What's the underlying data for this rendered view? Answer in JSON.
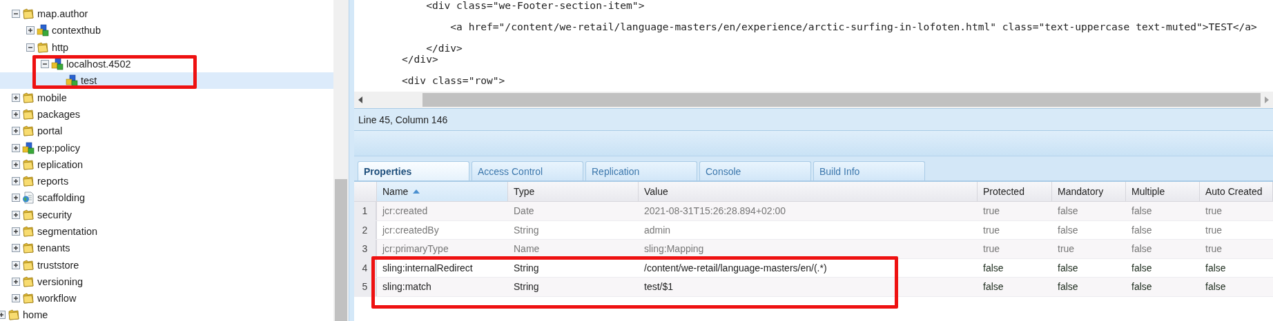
{
  "tree": [
    {
      "children": [
        {
          "label": "map.author",
          "kind": "folder",
          "expanded": true,
          "selected": false,
          "highlighted": false,
          "children": [
            {
              "label": "contexthub",
              "kind": "node",
              "expanded": false,
              "selected": false,
              "highlighted": false
            },
            {
              "label": "http",
              "kind": "folder",
              "expanded": true,
              "selected": false,
              "highlighted": false,
              "children": [
                {
                  "label": "localhost.4502",
                  "kind": "node",
                  "expanded": true,
                  "selected": false,
                  "highlighted": true,
                  "children": [
                    {
                      "label": "test",
                      "kind": "node",
                      "selected": true,
                      "highlighted": true
                    }
                  ]
                }
              ]
            }
          ]
        },
        {
          "label": "mobile",
          "kind": "folder",
          "expanded": false,
          "selected": false,
          "highlighted": false
        },
        {
          "label": "packages",
          "kind": "folder",
          "expanded": false,
          "selected": false,
          "highlighted": false
        },
        {
          "label": "portal",
          "kind": "folder",
          "expanded": false,
          "selected": false,
          "highlighted": false
        },
        {
          "label": "rep:policy",
          "kind": "node",
          "expanded": false,
          "selected": false,
          "highlighted": false
        },
        {
          "label": "replication",
          "kind": "folder",
          "expanded": false,
          "selected": false,
          "highlighted": false
        },
        {
          "label": "reports",
          "kind": "folder",
          "expanded": false,
          "selected": false,
          "highlighted": false
        },
        {
          "label": "scaffolding",
          "kind": "page",
          "expanded": false,
          "selected": false,
          "highlighted": false
        },
        {
          "label": "security",
          "kind": "folder",
          "expanded": false,
          "selected": false,
          "highlighted": false
        },
        {
          "label": "segmentation",
          "kind": "folder",
          "expanded": false,
          "selected": false,
          "highlighted": false
        },
        {
          "label": "tenants",
          "kind": "folder",
          "expanded": false,
          "selected": false,
          "highlighted": false
        },
        {
          "label": "truststore",
          "kind": "folder",
          "expanded": false,
          "selected": false,
          "highlighted": false
        },
        {
          "label": "versioning",
          "kind": "folder",
          "expanded": false,
          "selected": false,
          "highlighted": false
        },
        {
          "label": "workflow",
          "kind": "folder",
          "expanded": false,
          "selected": false,
          "highlighted": false
        }
      ]
    },
    {
      "label": "home",
      "kind": "folder",
      "expanded": false,
      "selected": false,
      "highlighted": false
    }
  ],
  "code_blocks": [
    [
      "    <div class=\"we-Footer-section-item\">"
    ],
    [
      "        <a href=\"/content/we-retail/language-masters/en/experience/arctic-surfing-in-lofoten.html\" class=\"text-uppercase text-muted\">TEST</a>"
    ],
    [
      "    </div>",
      "</div>"
    ],
    [
      "<div class=\"row\">"
    ]
  ],
  "status_bar": "Line 45, Column 146",
  "tabs": [
    {
      "label": "Properties",
      "selected": true
    },
    {
      "label": "Access Control",
      "selected": false
    },
    {
      "label": "Replication",
      "selected": false
    },
    {
      "label": "Console",
      "selected": false
    },
    {
      "label": "Build Info",
      "selected": false
    }
  ],
  "table": {
    "columns": [
      {
        "label": "Name",
        "sorted": true
      },
      {
        "label": "Type",
        "sorted": false
      },
      {
        "label": "Value",
        "sorted": false
      },
      {
        "label": "Protected",
        "sorted": false
      },
      {
        "label": "Mandatory",
        "sorted": false
      },
      {
        "label": "Multiple",
        "sorted": false
      },
      {
        "label": "Auto Created",
        "sorted": false
      }
    ],
    "rows": [
      {
        "number": "1",
        "cells": [
          "jcr:created",
          "Date",
          "2021-08-31T15:26:28.894+02:00",
          "true",
          "false",
          "false",
          "true"
        ],
        "disabled": true,
        "highlighted": false
      },
      {
        "number": "2",
        "cells": [
          "jcr:createdBy",
          "String",
          "admin",
          "true",
          "false",
          "false",
          "true"
        ],
        "disabled": true,
        "highlighted": false
      },
      {
        "number": "3",
        "cells": [
          "jcr:primaryType",
          "Name",
          "sling:Mapping",
          "true",
          "true",
          "false",
          "true"
        ],
        "disabled": true,
        "highlighted": false
      },
      {
        "number": "4",
        "cells": [
          "sling:internalRedirect",
          "String",
          "/content/we-retail/language-masters/en/(.*)",
          "false",
          "false",
          "false",
          "false"
        ],
        "disabled": false,
        "highlighted": true
      },
      {
        "number": "5",
        "cells": [
          "sling:match",
          "String",
          "test/$1",
          "false",
          "false",
          "false",
          "false"
        ],
        "disabled": false,
        "highlighted": true
      }
    ]
  }
}
